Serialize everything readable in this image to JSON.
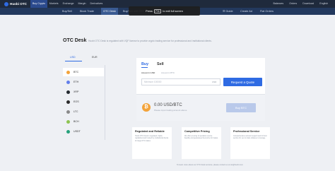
{
  "topnav": {
    "logo": "Huobi OTC",
    "items": [
      "Buy Crypto",
      "Markets",
      "Exchange",
      "Margin",
      "Derivatives"
    ],
    "active_index": 0,
    "right_items": [
      "Balances",
      "Orders",
      "Download",
      "English"
    ]
  },
  "subnav": {
    "items": [
      "Buy/Sell",
      "Block Trade",
      "OTC Desk",
      "Buy/Sell with TRY"
    ],
    "active_index": 2,
    "right_items": [
      "Guide",
      "Create Ad",
      "Fiat Orders"
    ]
  },
  "fullscreen_tip": {
    "before": "Press",
    "key": "F11",
    "after": "to exit full screen"
  },
  "page": {
    "title": "OTC Desk",
    "description": "Huobi OTC Desk is regulated with VQF license to provide crypto trading service for professional and institutional clients."
  },
  "currency_tabs": [
    "USD",
    "EUR"
  ],
  "currency_active": 0,
  "coins": [
    {
      "symbol": "BTC",
      "color": "#f3a33a"
    },
    {
      "symbol": "ETH",
      "color": "#627eea"
    },
    {
      "symbol": "XRP",
      "color": "#23292f"
    },
    {
      "symbol": "EOS",
      "color": "#2b2b2b"
    },
    {
      "symbol": "LTC",
      "color": "#8a8a8a"
    },
    {
      "symbol": "BCH",
      "color": "#8dc351"
    },
    {
      "symbol": "USDT",
      "color": "#26a17b"
    }
  ],
  "coin_active": 0,
  "order": {
    "mode_buy": "Buy",
    "mode_sell": "Sell",
    "amount_label": "Amount in USD",
    "amount_sub": "Amount in BTC",
    "amount_placeholder": "Minimum 100000",
    "amount_unit": "USD",
    "quote_button": "Request a Quote",
    "price": "0.00 USD/BTC",
    "price_hint": "Please input trading amount above",
    "buy_button": "Buy BTC"
  },
  "cards": [
    {
      "title": "Regulated and Reliable",
      "text": "Huobi OTC Desk is regulated, highly capitalized and trusted by institutional clients for large OTC trades."
    },
    {
      "title": "Competitive Pricing",
      "text": "We offer an array of quotation source liquidity and guaranteed best price for trades."
    },
    {
      "title": "Professional Service",
      "text": "Comprehensive account support and 24 hour service for you to trade whatever coverage."
    }
  ],
  "footer_note": "To learn more about our OTC Desk services, please contact us at otc@huobi.com",
  "colors": {
    "accent": "#2f6be3",
    "nav_bg": "#1f2a3c",
    "subnav_bg": "#23395e",
    "page_bg": "#eef0f4"
  }
}
